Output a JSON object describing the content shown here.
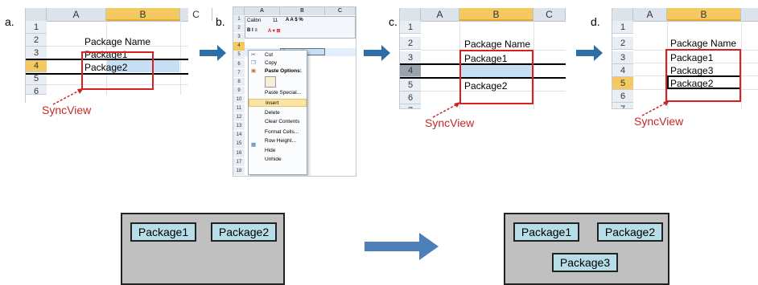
{
  "steps": {
    "a": "a.",
    "b": "b.",
    "c": "c.",
    "d": "d."
  },
  "columns": {
    "a": "A",
    "b": "B",
    "c": "C"
  },
  "rows": [
    "1",
    "2",
    "3",
    "4",
    "5",
    "6",
    "7"
  ],
  "sheet_a": {
    "header": "Package Name",
    "cells": [
      "Package1",
      "Package2"
    ],
    "sync_label": "SyncView"
  },
  "sheet_c": {
    "header": "Package Name",
    "cells": [
      "Package1",
      "",
      "Package2"
    ],
    "sync_label": "SyncView"
  },
  "sheet_d": {
    "header": "Package Name",
    "cells": [
      "Package1",
      "Package3",
      "Package2"
    ],
    "sync_label": "SyncView"
  },
  "context_menu": {
    "toolbar_font": "Calibri",
    "toolbar_size": "11",
    "cell_text": "Package2",
    "items": [
      "Cut",
      "Copy",
      "Paste Options:",
      "Paste Special...",
      "Insert",
      "Delete",
      "Clear Contents",
      "Format Cells...",
      "Row Height...",
      "Hide",
      "Unhide"
    ],
    "highlighted": "Insert",
    "row_numbers": [
      "1",
      "2",
      "3",
      "4",
      "5",
      "6",
      "7",
      "8",
      "9",
      "10",
      "11",
      "12",
      "13",
      "14",
      "15",
      "16",
      "17",
      "18"
    ]
  },
  "panel_left": {
    "packages": [
      "Package1",
      "Package2"
    ]
  },
  "panel_right": {
    "packages": [
      "Package1",
      "Package2",
      "Package3"
    ]
  },
  "colors": {
    "red": "#d92020",
    "panel_bg": "#c0c0c0",
    "package_bg": "#b7dde8",
    "arrow": "#2e6ea6"
  }
}
